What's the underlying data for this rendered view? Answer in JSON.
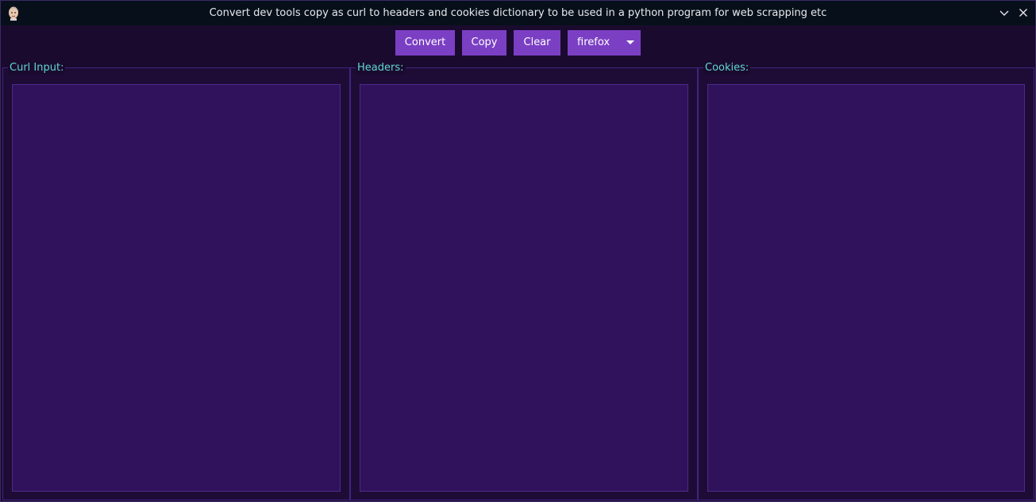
{
  "window": {
    "title": "Convert dev tools copy as curl to headers and cookies dictionary to be used in a python program for web scrapping etc"
  },
  "toolbar": {
    "convert_label": "Convert",
    "copy_label": "Copy",
    "clear_label": "Clear",
    "browser_select": {
      "selected": "firefox"
    }
  },
  "panels": {
    "curl": {
      "label": "Curl Input:",
      "value": ""
    },
    "headers": {
      "label": "Headers:",
      "value": ""
    },
    "cookies": {
      "label": "Cookies:",
      "value": ""
    }
  },
  "icons": {
    "app": "app-icon",
    "minimize": "chevron-down-icon",
    "close": "close-icon",
    "dropdown": "caret-down-icon"
  },
  "colors": {
    "background": "#1a0b2e",
    "titlebar": "#07101a",
    "accent": "#7b3fc4",
    "label": "#5fd6d2",
    "textarea": "#30125c"
  }
}
